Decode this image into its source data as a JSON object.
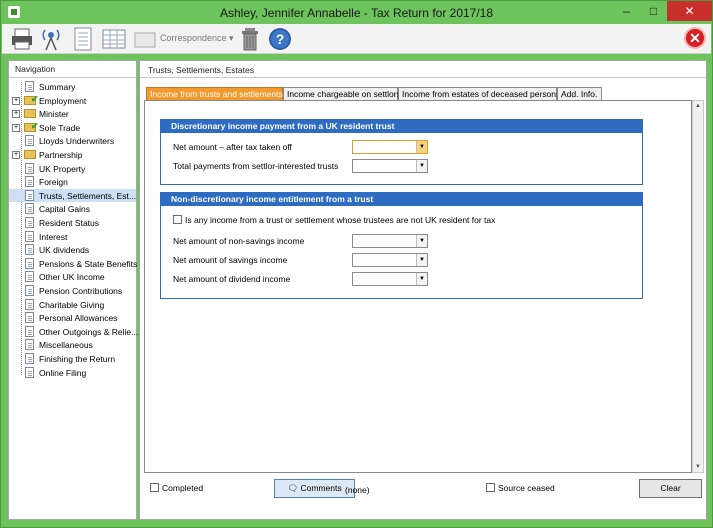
{
  "window": {
    "title": "Ashley, Jennifer Annabelle - Tax Return for 2017/18"
  },
  "toolbar": {
    "correspondence_label": "Correspondence"
  },
  "navigation": {
    "header": "Navigation",
    "items": [
      {
        "label": "Summary",
        "icon": "doc",
        "expandable": false,
        "checked": false
      },
      {
        "label": "Employment",
        "icon": "folder",
        "expandable": true,
        "checked": true
      },
      {
        "label": "Minister",
        "icon": "folder",
        "expandable": true,
        "checked": false
      },
      {
        "label": "Sole Trade",
        "icon": "folder",
        "expandable": true,
        "checked": true
      },
      {
        "label": "Lloyds Underwriters",
        "icon": "doc",
        "expandable": false,
        "checked": false
      },
      {
        "label": "Partnership",
        "icon": "folder",
        "expandable": true,
        "checked": false
      },
      {
        "label": "UK Property",
        "icon": "doc",
        "expandable": false,
        "checked": false
      },
      {
        "label": "Foreign",
        "icon": "doc",
        "expandable": false,
        "checked": false
      },
      {
        "label": "Trusts, Settlements, Est...",
        "icon": "doc",
        "expandable": false,
        "checked": false,
        "selected": true
      },
      {
        "label": "Capital Gains",
        "icon": "doc",
        "expandable": false,
        "checked": false
      },
      {
        "label": "Resident Status",
        "icon": "doc",
        "expandable": false,
        "checked": false
      },
      {
        "label": "Interest",
        "icon": "doc",
        "expandable": false,
        "checked": false
      },
      {
        "label": "UK dividends",
        "icon": "doc",
        "expandable": false,
        "checked": false
      },
      {
        "label": "Pensions & State Benefits",
        "icon": "doc",
        "expandable": false,
        "checked": false
      },
      {
        "label": "Other UK Income",
        "icon": "doc",
        "expandable": false,
        "checked": false
      },
      {
        "label": "Pension Contributions",
        "icon": "doc",
        "expandable": false,
        "checked": false
      },
      {
        "label": "Charitable Giving",
        "icon": "doc",
        "expandable": false,
        "checked": false
      },
      {
        "label": "Personal Allowances",
        "icon": "doc",
        "expandable": false,
        "checked": false
      },
      {
        "label": "Other Outgoings & Relie...",
        "icon": "doc",
        "expandable": false,
        "checked": false
      },
      {
        "label": "Miscellaneous",
        "icon": "doc",
        "expandable": false,
        "checked": false
      },
      {
        "label": "Finishing the Return",
        "icon": "doc",
        "expandable": false,
        "checked": false
      },
      {
        "label": "Online Filing",
        "icon": "doc",
        "expandable": false,
        "checked": false
      }
    ]
  },
  "main": {
    "header": "Trusts, Settlements, Estates",
    "tabs": [
      {
        "label": "Income from trusts and settlements",
        "active": true
      },
      {
        "label": "Income chargeable on settlors",
        "active": false
      },
      {
        "label": "Income from estates of deceased persons",
        "active": false
      },
      {
        "label": "Add. Info.",
        "active": false
      }
    ],
    "group1": {
      "title": "Discretionary income payment from a UK resident trust",
      "net_amount_label": "Net amount – after tax taken off",
      "total_payments_label": "Total payments from settlor-interested trusts"
    },
    "group2": {
      "title": "Non-discretionary income entitlement from a trust",
      "checkbox_label": "Is any income from a trust or settlement whose trustees are not UK resident for tax",
      "non_savings_label": "Net amount of non-savings income",
      "savings_label": "Net amount of savings income",
      "dividend_label": "Net amount of dividend income"
    }
  },
  "footer": {
    "completed_label": "Completed",
    "comments_label": "Comments",
    "comments_status": "(none)",
    "source_ceased_label": "Source ceased",
    "clear_label": "Clear"
  },
  "colors": {
    "window_frame": "#6dc35c",
    "active_tab": "#f29a2e",
    "group_header": "#2e6cc2"
  }
}
